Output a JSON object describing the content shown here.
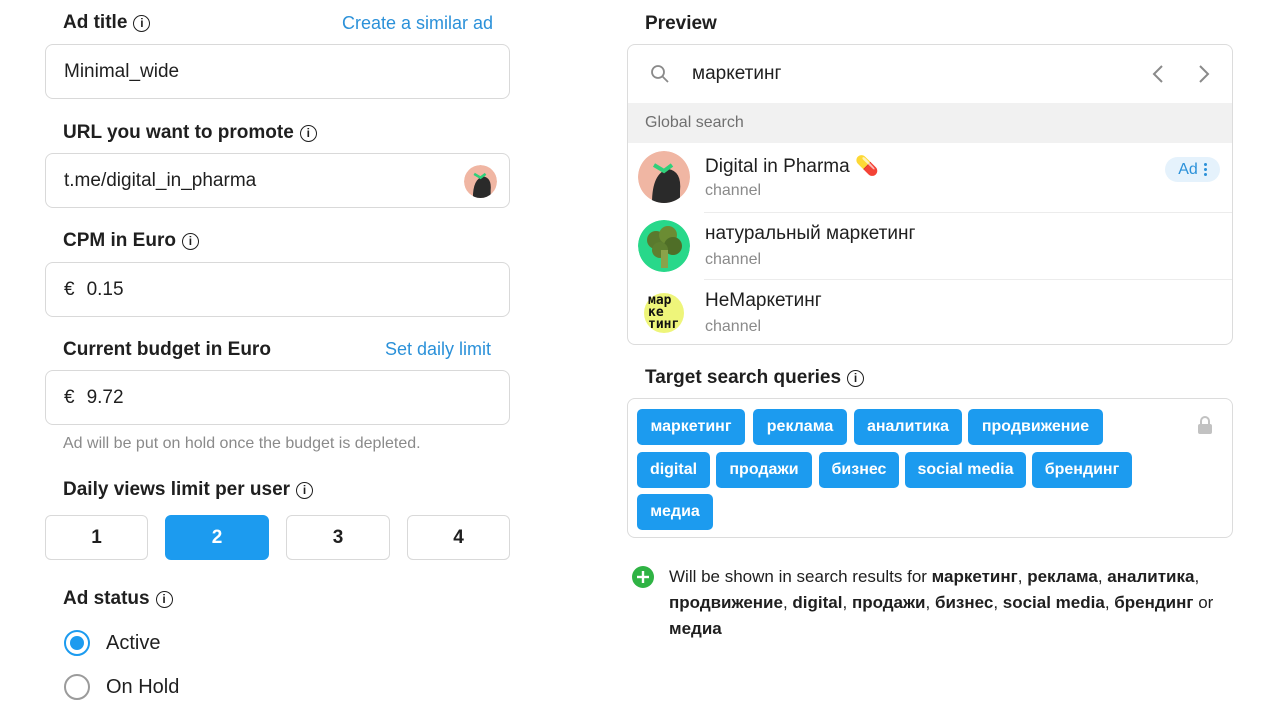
{
  "form": {
    "ad_title": {
      "label": "Ad title",
      "link": "Create a similar ad",
      "value": "Minimal_wide"
    },
    "url": {
      "label": "URL you want to promote",
      "value": "t.me/digital_in_pharma"
    },
    "cpm": {
      "label": "CPM in Euro",
      "currency": "€",
      "value": "0.15"
    },
    "budget": {
      "label": "Current budget in Euro",
      "link": "Set daily limit",
      "currency": "€",
      "value": "9.72",
      "hint": "Ad will be put on hold once the budget is depleted."
    },
    "daily_views": {
      "label": "Daily views limit per user",
      "options": [
        "1",
        "2",
        "3",
        "4"
      ],
      "selected": "2"
    },
    "status": {
      "label": "Ad status",
      "options": [
        "Active",
        "On Hold"
      ],
      "selected": "Active"
    }
  },
  "preview": {
    "title": "Preview",
    "search_query": "маркетинг",
    "section": "Global search",
    "results": [
      {
        "name": "Digital in Pharma",
        "emoji": "💊",
        "type": "channel",
        "badge": "Ad"
      },
      {
        "name": "натуральный маркетинг",
        "type": "channel"
      },
      {
        "name": "НеМаркетинг",
        "type": "channel",
        "logo_text": [
          "мар",
          "ке",
          "тинг"
        ]
      }
    ]
  },
  "targets": {
    "label": "Target search queries",
    "chips": [
      "маркетинг",
      "реклама",
      "аналитика",
      "продвижение",
      "digital",
      "продажи",
      "бизнес",
      "social media",
      "брендинг",
      "медиа"
    ],
    "note_prefix": "Will be shown in search results for",
    "note_or": "or"
  },
  "colors": {
    "accent": "#1c9bef",
    "link": "#2b91d9",
    "success": "#2fb344",
    "muted": "#8a8a8a"
  },
  "icons": {
    "info": "i",
    "search": "search-icon",
    "prev": "chevron-left-icon",
    "next": "chevron-right-icon",
    "lock": "lock-icon",
    "plus": "plus-circle-icon"
  }
}
